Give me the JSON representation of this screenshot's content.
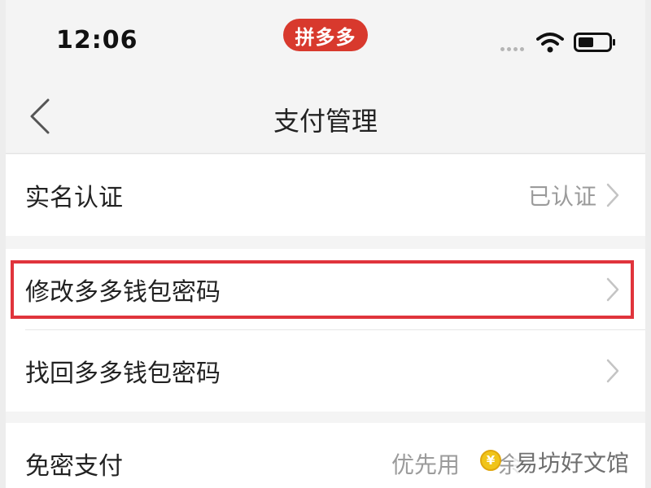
{
  "status_bar": {
    "time": "12:06",
    "app_badge": "拼多多",
    "icons": [
      "signal-dots-icon",
      "wifi-icon",
      "battery-icon"
    ]
  },
  "nav": {
    "back_icon": "back-chevron-icon",
    "title": "支付管理"
  },
  "rows": {
    "real_name": {
      "label": "实名认证",
      "value": "已认证"
    },
    "change_password": {
      "label": "修改多多钱包密码",
      "highlighted": true
    },
    "recover_password": {
      "label": "找回多多钱包密码"
    },
    "password_free": {
      "label": "免密支付",
      "value_prefix": "优先用",
      "value_suffix": "余"
    }
  },
  "watermark": "易坊好文馆",
  "colors": {
    "brand_red": "#d8392d",
    "highlight_border": "#e0343c",
    "coin_gold": "#f0c419"
  }
}
